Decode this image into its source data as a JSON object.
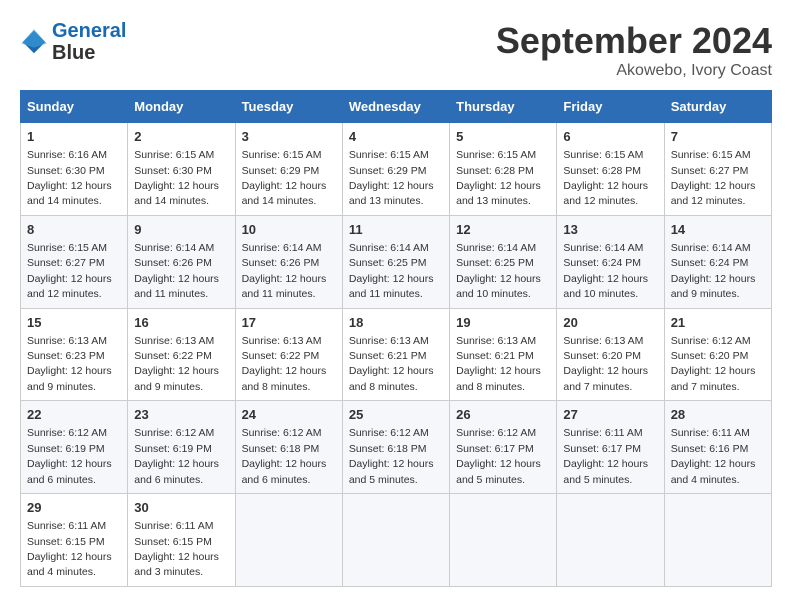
{
  "header": {
    "logo_line1": "General",
    "logo_line2": "Blue",
    "month": "September 2024",
    "location": "Akowebo, Ivory Coast"
  },
  "days_of_week": [
    "Sunday",
    "Monday",
    "Tuesday",
    "Wednesday",
    "Thursday",
    "Friday",
    "Saturday"
  ],
  "weeks": [
    [
      {
        "day": "1",
        "sunrise": "6:16 AM",
        "sunset": "6:30 PM",
        "daylight": "12 hours and 14 minutes."
      },
      {
        "day": "2",
        "sunrise": "6:15 AM",
        "sunset": "6:30 PM",
        "daylight": "12 hours and 14 minutes."
      },
      {
        "day": "3",
        "sunrise": "6:15 AM",
        "sunset": "6:29 PM",
        "daylight": "12 hours and 14 minutes."
      },
      {
        "day": "4",
        "sunrise": "6:15 AM",
        "sunset": "6:29 PM",
        "daylight": "12 hours and 13 minutes."
      },
      {
        "day": "5",
        "sunrise": "6:15 AM",
        "sunset": "6:28 PM",
        "daylight": "12 hours and 13 minutes."
      },
      {
        "day": "6",
        "sunrise": "6:15 AM",
        "sunset": "6:28 PM",
        "daylight": "12 hours and 12 minutes."
      },
      {
        "day": "7",
        "sunrise": "6:15 AM",
        "sunset": "6:27 PM",
        "daylight": "12 hours and 12 minutes."
      }
    ],
    [
      {
        "day": "8",
        "sunrise": "6:15 AM",
        "sunset": "6:27 PM",
        "daylight": "12 hours and 12 minutes."
      },
      {
        "day": "9",
        "sunrise": "6:14 AM",
        "sunset": "6:26 PM",
        "daylight": "12 hours and 11 minutes."
      },
      {
        "day": "10",
        "sunrise": "6:14 AM",
        "sunset": "6:26 PM",
        "daylight": "12 hours and 11 minutes."
      },
      {
        "day": "11",
        "sunrise": "6:14 AM",
        "sunset": "6:25 PM",
        "daylight": "12 hours and 11 minutes."
      },
      {
        "day": "12",
        "sunrise": "6:14 AM",
        "sunset": "6:25 PM",
        "daylight": "12 hours and 10 minutes."
      },
      {
        "day": "13",
        "sunrise": "6:14 AM",
        "sunset": "6:24 PM",
        "daylight": "12 hours and 10 minutes."
      },
      {
        "day": "14",
        "sunrise": "6:14 AM",
        "sunset": "6:24 PM",
        "daylight": "12 hours and 9 minutes."
      }
    ],
    [
      {
        "day": "15",
        "sunrise": "6:13 AM",
        "sunset": "6:23 PM",
        "daylight": "12 hours and 9 minutes."
      },
      {
        "day": "16",
        "sunrise": "6:13 AM",
        "sunset": "6:22 PM",
        "daylight": "12 hours and 9 minutes."
      },
      {
        "day": "17",
        "sunrise": "6:13 AM",
        "sunset": "6:22 PM",
        "daylight": "12 hours and 8 minutes."
      },
      {
        "day": "18",
        "sunrise": "6:13 AM",
        "sunset": "6:21 PM",
        "daylight": "12 hours and 8 minutes."
      },
      {
        "day": "19",
        "sunrise": "6:13 AM",
        "sunset": "6:21 PM",
        "daylight": "12 hours and 8 minutes."
      },
      {
        "day": "20",
        "sunrise": "6:13 AM",
        "sunset": "6:20 PM",
        "daylight": "12 hours and 7 minutes."
      },
      {
        "day": "21",
        "sunrise": "6:12 AM",
        "sunset": "6:20 PM",
        "daylight": "12 hours and 7 minutes."
      }
    ],
    [
      {
        "day": "22",
        "sunrise": "6:12 AM",
        "sunset": "6:19 PM",
        "daylight": "12 hours and 6 minutes."
      },
      {
        "day": "23",
        "sunrise": "6:12 AM",
        "sunset": "6:19 PM",
        "daylight": "12 hours and 6 minutes."
      },
      {
        "day": "24",
        "sunrise": "6:12 AM",
        "sunset": "6:18 PM",
        "daylight": "12 hours and 6 minutes."
      },
      {
        "day": "25",
        "sunrise": "6:12 AM",
        "sunset": "6:18 PM",
        "daylight": "12 hours and 5 minutes."
      },
      {
        "day": "26",
        "sunrise": "6:12 AM",
        "sunset": "6:17 PM",
        "daylight": "12 hours and 5 minutes."
      },
      {
        "day": "27",
        "sunrise": "6:11 AM",
        "sunset": "6:17 PM",
        "daylight": "12 hours and 5 minutes."
      },
      {
        "day": "28",
        "sunrise": "6:11 AM",
        "sunset": "6:16 PM",
        "daylight": "12 hours and 4 minutes."
      }
    ],
    [
      {
        "day": "29",
        "sunrise": "6:11 AM",
        "sunset": "6:15 PM",
        "daylight": "12 hours and 4 minutes."
      },
      {
        "day": "30",
        "sunrise": "6:11 AM",
        "sunset": "6:15 PM",
        "daylight": "12 hours and 3 minutes."
      },
      null,
      null,
      null,
      null,
      null
    ]
  ]
}
